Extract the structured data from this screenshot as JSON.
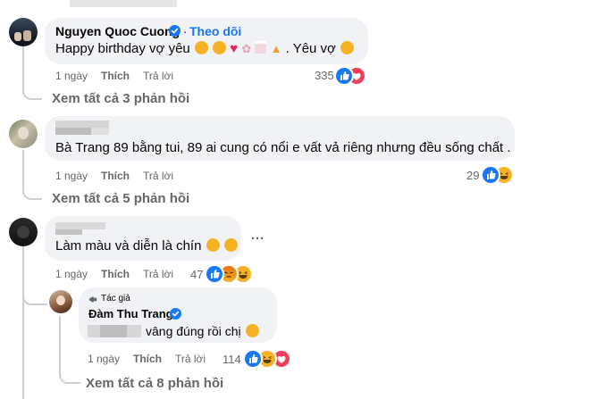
{
  "comment1": {
    "author": "Nguyen Quoc Cuong",
    "follow": "Theo dõi",
    "text": "Happy birthday vợ yêu",
    "text_tail": ". Yêu vợ",
    "time": "1 ngày",
    "like": "Thích",
    "reply": "Trả lời",
    "reaction_count": "335",
    "view_replies": "Xem tất cả 3 phản hồi"
  },
  "comment2": {
    "text": "Bà Trang 89 bằng tui, 89 ai cung có nổi e vất vả riêng nhưng đều sống chất .",
    "time": "1 ngày",
    "like": "Thích",
    "reply": "Trả lời",
    "reaction_count": "29",
    "view_replies": "Xem tất cả 5 phản hồi"
  },
  "comment3": {
    "text": "Làm màu và diễn là chín",
    "more": "···",
    "time": "1 ngày",
    "like": "Thích",
    "reply": "Trả lời",
    "reaction_count": "47"
  },
  "reply1": {
    "badge": "Tác giả",
    "author": "Đàm Thu Trang",
    "text": "vâng đúng rồi chị",
    "time": "1 ngày",
    "like": "Thích",
    "reply": "Trả lời",
    "reaction_count": "114",
    "view_replies": "Xem tất cả 8 phản hồi"
  },
  "colors": {
    "like_blue": "#1877f2",
    "love_red": "#f33e58",
    "haha_yellow": "#f7b125",
    "angry_orange": "#e9710f",
    "verified_blue": "#1877f2"
  },
  "icons": [
    "like-reaction-icon",
    "love-reaction-icon",
    "haha-reaction-icon",
    "angry-reaction-icon",
    "verified-badge-icon",
    "more-options-icon",
    "author-badge-icon"
  ]
}
